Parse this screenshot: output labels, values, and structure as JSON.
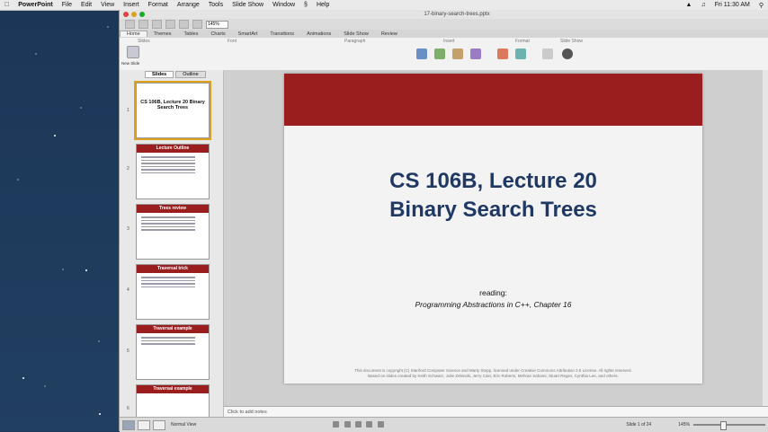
{
  "menubar": {
    "app": "PowerPoint",
    "items": [
      "File",
      "Edit",
      "View",
      "Insert",
      "Format",
      "Arrange",
      "Tools",
      "Slide Show",
      "Window",
      "Help"
    ],
    "clock": "Fri 11:30 AM"
  },
  "window": {
    "title": "17-binary-search-trees.pptx"
  },
  "toolbar": {
    "zoom": "145%"
  },
  "ribbon": {
    "tabs": [
      "Home",
      "Themes",
      "Tables",
      "Charts",
      "SmartArt",
      "Transitions",
      "Animations",
      "Slide Show",
      "Review"
    ],
    "active_tab": "Home",
    "groups": [
      "Slides",
      "Font",
      "Paragraph",
      "Insert",
      "Format",
      "Slide Show"
    ],
    "new_slide_label": "New Slide"
  },
  "panel": {
    "tabs": [
      "Slides",
      "Outline"
    ],
    "thumbnails": [
      {
        "num": "1",
        "bar": "",
        "title": "CS 106B, Lecture 20 Binary Search Trees"
      },
      {
        "num": "2",
        "bar": "Lecture Outline",
        "title": ""
      },
      {
        "num": "3",
        "bar": "Trees review",
        "title": ""
      },
      {
        "num": "4",
        "bar": "Traversal trick",
        "title": ""
      },
      {
        "num": "5",
        "bar": "Traversal example",
        "title": ""
      },
      {
        "num": "6",
        "bar": "Traversal example",
        "title": ""
      }
    ]
  },
  "slide": {
    "title_line1": "CS 106B, Lecture 20",
    "title_line2": "Binary Search Trees",
    "reading_label": "reading:",
    "reading_text": "Programming Abstractions in C++, Chapter 16",
    "footer_line1": "This document is copyright (C) Stanford Computer Science and Marty Stepp, licensed under Creative Commons Attribution 2.5 License. All rights reserved.",
    "footer_line2": "Based on slides created by Keith Schwarz, Julie Zelenski, Jerry Cain, Eric Roberts, Mehran Sahami, Stuart Reges, Cynthia Lee, and others."
  },
  "notes": {
    "placeholder": "Click to add notes"
  },
  "status": {
    "view": "Normal View",
    "slide_count": "Slide 1 of 24",
    "zoom": "145%"
  },
  "colors": {
    "accent_red": "#9b1e1e",
    "title_blue": "#1f3864"
  }
}
